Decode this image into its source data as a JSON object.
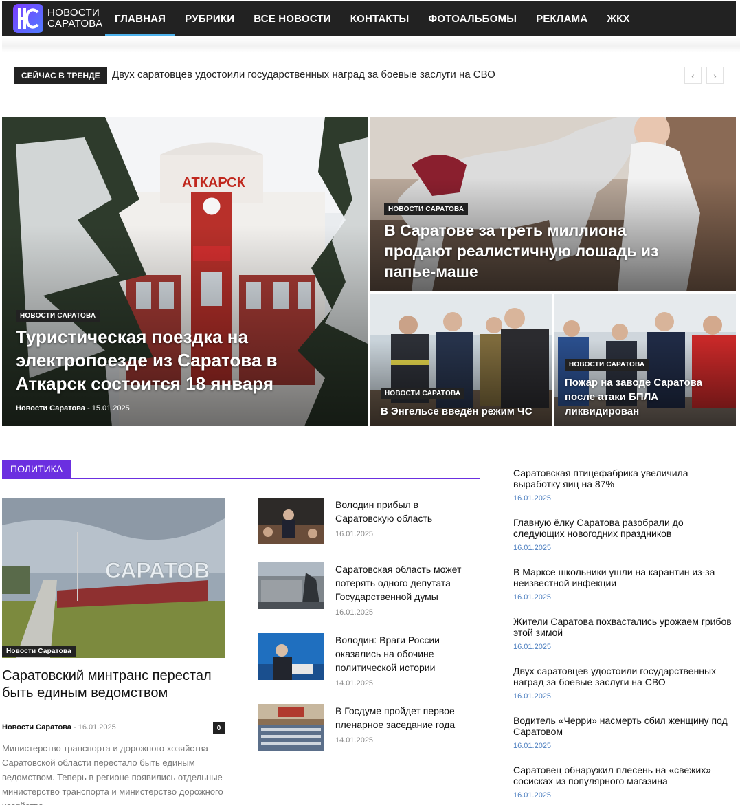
{
  "brand": {
    "line1": "НОВОСТИ",
    "line2": "САРАТОВА",
    "accent": "#6b2fe0"
  },
  "nav": [
    {
      "label": "ГЛАВНАЯ",
      "active": true
    },
    {
      "label": "РУБРИКИ"
    },
    {
      "label": "ВСЕ НОВОСТИ"
    },
    {
      "label": "КОНТАКТЫ"
    },
    {
      "label": "ФОТОАЛЬБОМЫ"
    },
    {
      "label": "РЕКЛАМА"
    },
    {
      "label": "ЖКХ"
    }
  ],
  "trending": {
    "label": "СЕЙЧАС В ТРЕНДЕ",
    "headline": "Двух саратовцев удостоили государственных наград за боевые заслуги на СВО",
    "prev_icon": "chevron-left-icon",
    "next_icon": "chevron-right-icon"
  },
  "featured": {
    "main": {
      "category": "НОВОСТИ САРАТОВА",
      "title": "Туристическая поездка на электропоезде из Саратова в Аткарск состоится 18 января",
      "author": "Новости Саратова",
      "separator": "-",
      "date": "15.01.2025",
      "sign_text": "АТКАРСК"
    },
    "top_right": {
      "category": "НОВОСТИ САРАТОВА",
      "title": "В Саратове за треть миллиона продают реалистичную лошадь из папье-маше"
    },
    "bottom_left": {
      "category": "НОВОСТИ САРАТОВА",
      "title": "В Энгельсе введён режим ЧС"
    },
    "bottom_right": {
      "category": "НОВОСТИ САРАТОВА",
      "title": "Пожар на заводе Саратова после атаки БПЛА ликвидирован"
    }
  },
  "politics": {
    "section_label": "ПОЛИТИКА",
    "lead": {
      "image_badge": "Новости Саратова",
      "image_sign": "САРАТОВ",
      "title": "Саратовский минтранс перестал быть единым ведомством",
      "author": "Новости Саратова",
      "separator": "-",
      "date": "16.01.2025",
      "comments": "0",
      "excerpt": "Министерство транспорта и дорожного хозяйства Саратовской области перестало быть единым ведомством. Теперь в регионе появились отдельные министерство транспорта и министерство дорожного хозяйства"
    },
    "items": [
      {
        "title": "Володин прибыл в Саратовскую область",
        "date": "16.01.2025"
      },
      {
        "title": "Саратовская область может потерять одного депутата Государственной думы",
        "date": "16.01.2025"
      },
      {
        "title": "Володин: Враги России оказались на обочине политической истории",
        "date": "14.01.2025"
      },
      {
        "title": "В Госдуме пройдет первое пленарное заседание года",
        "date": "14.01.2025"
      }
    ]
  },
  "sidebar_news": [
    {
      "title": "Саратовская птицефабрика увеличила выработку яиц на 87%",
      "date": "16.01.2025"
    },
    {
      "title": "Главную ёлку Саратова разобрали до следующих новогодних праздников",
      "date": "16.01.2025"
    },
    {
      "title": "В Марксе школьники ушли на карантин из-за неизвестной инфекции",
      "date": "16.01.2025"
    },
    {
      "title": "Жители Саратова похвастались урожаем грибов этой зимой",
      "date": "16.01.2025"
    },
    {
      "title": "Двух саратовцев удостоили государственных наград за боевые заслуги на СВО",
      "date": "16.01.2025"
    },
    {
      "title": "Водитель «Черри» насмерть сбил женщину под Саратовом",
      "date": "16.01.2025"
    },
    {
      "title": "Саратовец обнаружил плесень на «свежих» сосисках из популярного магазина",
      "date": "16.01.2025"
    }
  ]
}
